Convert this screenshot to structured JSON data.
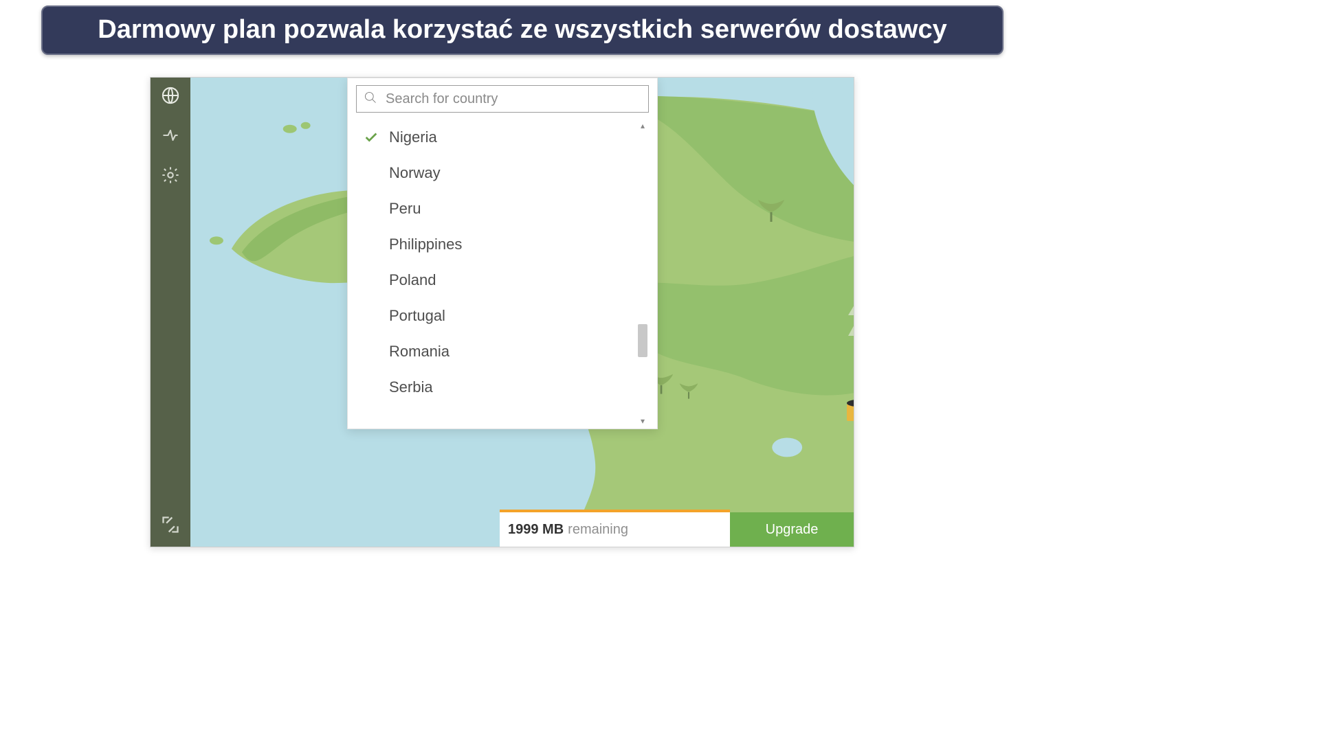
{
  "banner": {
    "text": "Darmowy plan pozwala korzystać ze wszystkich serwerów dostawcy"
  },
  "sidebar": {
    "icons": {
      "globe": "globe-icon",
      "split": "split-tunnel-icon",
      "settings": "gear-icon",
      "collapse": "collapse-icon"
    }
  },
  "search": {
    "placeholder": "Search for country"
  },
  "countries": [
    {
      "name": "Nigeria",
      "selected": true
    },
    {
      "name": "Norway",
      "selected": false
    },
    {
      "name": "Peru",
      "selected": false
    },
    {
      "name": "Philippines",
      "selected": false
    },
    {
      "name": "Poland",
      "selected": false
    },
    {
      "name": "Portugal",
      "selected": false
    },
    {
      "name": "Romania",
      "selected": false
    },
    {
      "name": "Serbia",
      "selected": false
    }
  ],
  "footer": {
    "remaining_amount": "1999 MB",
    "remaining_label": "remaining",
    "upgrade_label": "Upgrade"
  },
  "colors": {
    "banner_bg": "#333a5a",
    "sidebar_bg": "#566149",
    "water": "#b7dde6",
    "land_light": "#a7c77b",
    "land_dark": "#8fb863",
    "accent_green": "#6fb04e",
    "accent_orange": "#f4a32a"
  }
}
